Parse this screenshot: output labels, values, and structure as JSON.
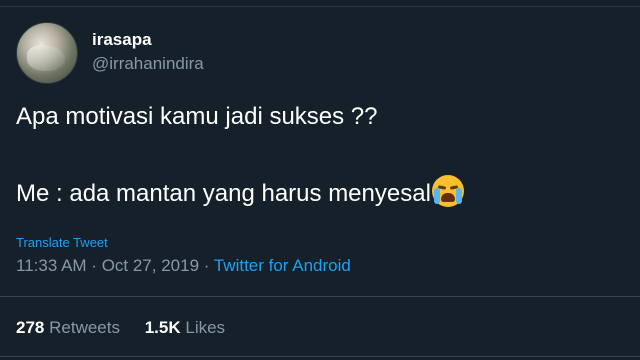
{
  "user": {
    "display_name": "irasapa",
    "handle": "@irrahanindira"
  },
  "tweet": {
    "line1": "Apa motivasi kamu jadi sukses ??",
    "line2": "Me : ada mantan yang harus menyesal",
    "emoji": "loudly-crying-face-icon",
    "translate_label": "Translate Tweet",
    "time": "11:33 AM",
    "separator1": " · ",
    "date": "Oct 27, 2019",
    "separator2": " · ",
    "source": "Twitter for Android"
  },
  "stats": {
    "retweets_count": "278",
    "retweets_label": "Retweets",
    "likes_count": "1.5K",
    "likes_label": "Likes"
  },
  "colors": {
    "background": "#15202b",
    "link": "#1da1f2",
    "secondary_text": "#8899a6",
    "primary_text": "#ffffff"
  }
}
